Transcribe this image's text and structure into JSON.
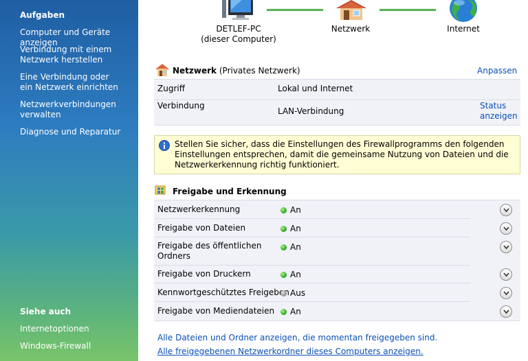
{
  "sidebar": {
    "tasks_heading": "Aufgaben",
    "tasks": [
      "Computer und Geräte anzeigen",
      "Verbindung mit einem Netzwerk herstellen",
      "Eine Verbindung oder ein Netzwerk einrichten",
      "Netzwerkverbindungen verwalten",
      "Diagnose und Reparatur"
    ],
    "see_also_heading": "Siehe auch",
    "see_also": [
      "Internetoptionen",
      "Windows-Firewall"
    ]
  },
  "map": {
    "computer_name": "DETLEF-PC",
    "computer_sub": "(dieser Computer)",
    "network": "Netzwerk",
    "internet": "Internet"
  },
  "network_section": {
    "title": "Netzwerk",
    "type": "(Privates Netzwerk)",
    "customize": "Anpassen",
    "rows": [
      {
        "label": "Zugriff",
        "value": "Lokal und Internet"
      },
      {
        "label": "Verbindung",
        "value": "LAN-Verbindung",
        "action": "Status anzeigen"
      }
    ]
  },
  "info_message": "Stellen Sie sicher, dass die Einstellungen des Firewallprogramms den folgenden Einstellungen entsprechen, damit die gemeinsame Nutzung von Dateien und die Netzwerkerkennung richtig funktioniert.",
  "sharing_section": {
    "title": "Freigabe und Erkennung",
    "items": [
      {
        "label": "Netzwerkerkennung",
        "state": "An",
        "on": true
      },
      {
        "label": "Freigabe von Dateien",
        "state": "An",
        "on": true
      },
      {
        "label": "Freigabe des öffentlichen Ordners",
        "state": "An",
        "on": true
      },
      {
        "label": "Freigabe von Druckern",
        "state": "An",
        "on": true
      },
      {
        "label": "Kennwortgeschütztes Freigeben",
        "state": "Aus",
        "on": false
      },
      {
        "label": "Freigabe von Mediendateien",
        "state": "An",
        "on": true
      }
    ]
  },
  "bottom_links": [
    "Alle Dateien und Ordner anzeigen, die momentan freigegeben sind.",
    "Alle freigegebenen Netzwerkordner dieses Computers anzeigen."
  ]
}
